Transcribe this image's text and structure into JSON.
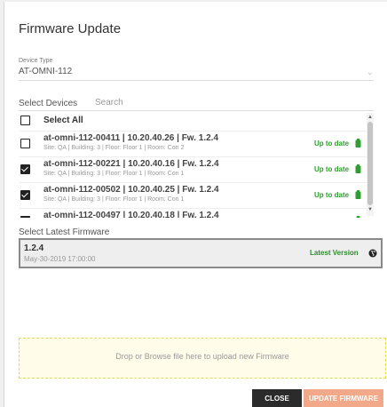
{
  "dialog": {
    "title": "Firmware Update"
  },
  "device_type": {
    "label": "Device Type",
    "value": "AT-OMNI-112",
    "chevron": "⌄"
  },
  "devices": {
    "label": "Select Devices",
    "search_placeholder": "Search",
    "select_all_label": "Select All",
    "select_all_checked": false,
    "items": [
      {
        "title": "at-omni-112-00411 | 10.20.40.26 | Fw. 1.2.4",
        "subtitle": "Site: QA | Building: 3 | Floor: Floor 1 | Room: Con 2",
        "status": "Up to date",
        "checked": false,
        "icon": "battery-icon"
      },
      {
        "title": "at-omni-112-00221 | 10.20.40.16 | Fw. 1.2.4",
        "subtitle": "Site: QA | Building: 3 | Floor: Floor 1 | Room: Con 1",
        "status": "Up to date",
        "checked": true,
        "icon": "battery-icon"
      },
      {
        "title": "at-omni-112-00502 | 10.20.40.25 | Fw. 1.2.4",
        "subtitle": "Site: QA | Building: 3 | Floor: Floor 1 | Room: Con 1",
        "status": "Up to date",
        "checked": true,
        "icon": "battery-icon"
      },
      {
        "title": "at-omni-112-00497 | 10.20.40.18 | Fw. 1.2.4",
        "subtitle": "",
        "status": "",
        "checked": true,
        "icon": "battery-icon"
      }
    ]
  },
  "firmware": {
    "label": "Select Latest Firmware",
    "version": "1.2.4",
    "date": "May-30-2019 17:00:00",
    "status": "Latest Version",
    "icon": "globe-icon"
  },
  "dropzone": {
    "text": "Drop or Browse file here to upload new Firmware"
  },
  "buttons": {
    "close": "CLOSE",
    "update": "UPDATE FIRMWARE"
  },
  "colors": {
    "status_green": "#2e9e2e",
    "close_button": "#2b2b2b",
    "update_button": "#f2a98a",
    "dropzone_bg": "#fffcea",
    "dropzone_border": "#e4dd4c"
  }
}
